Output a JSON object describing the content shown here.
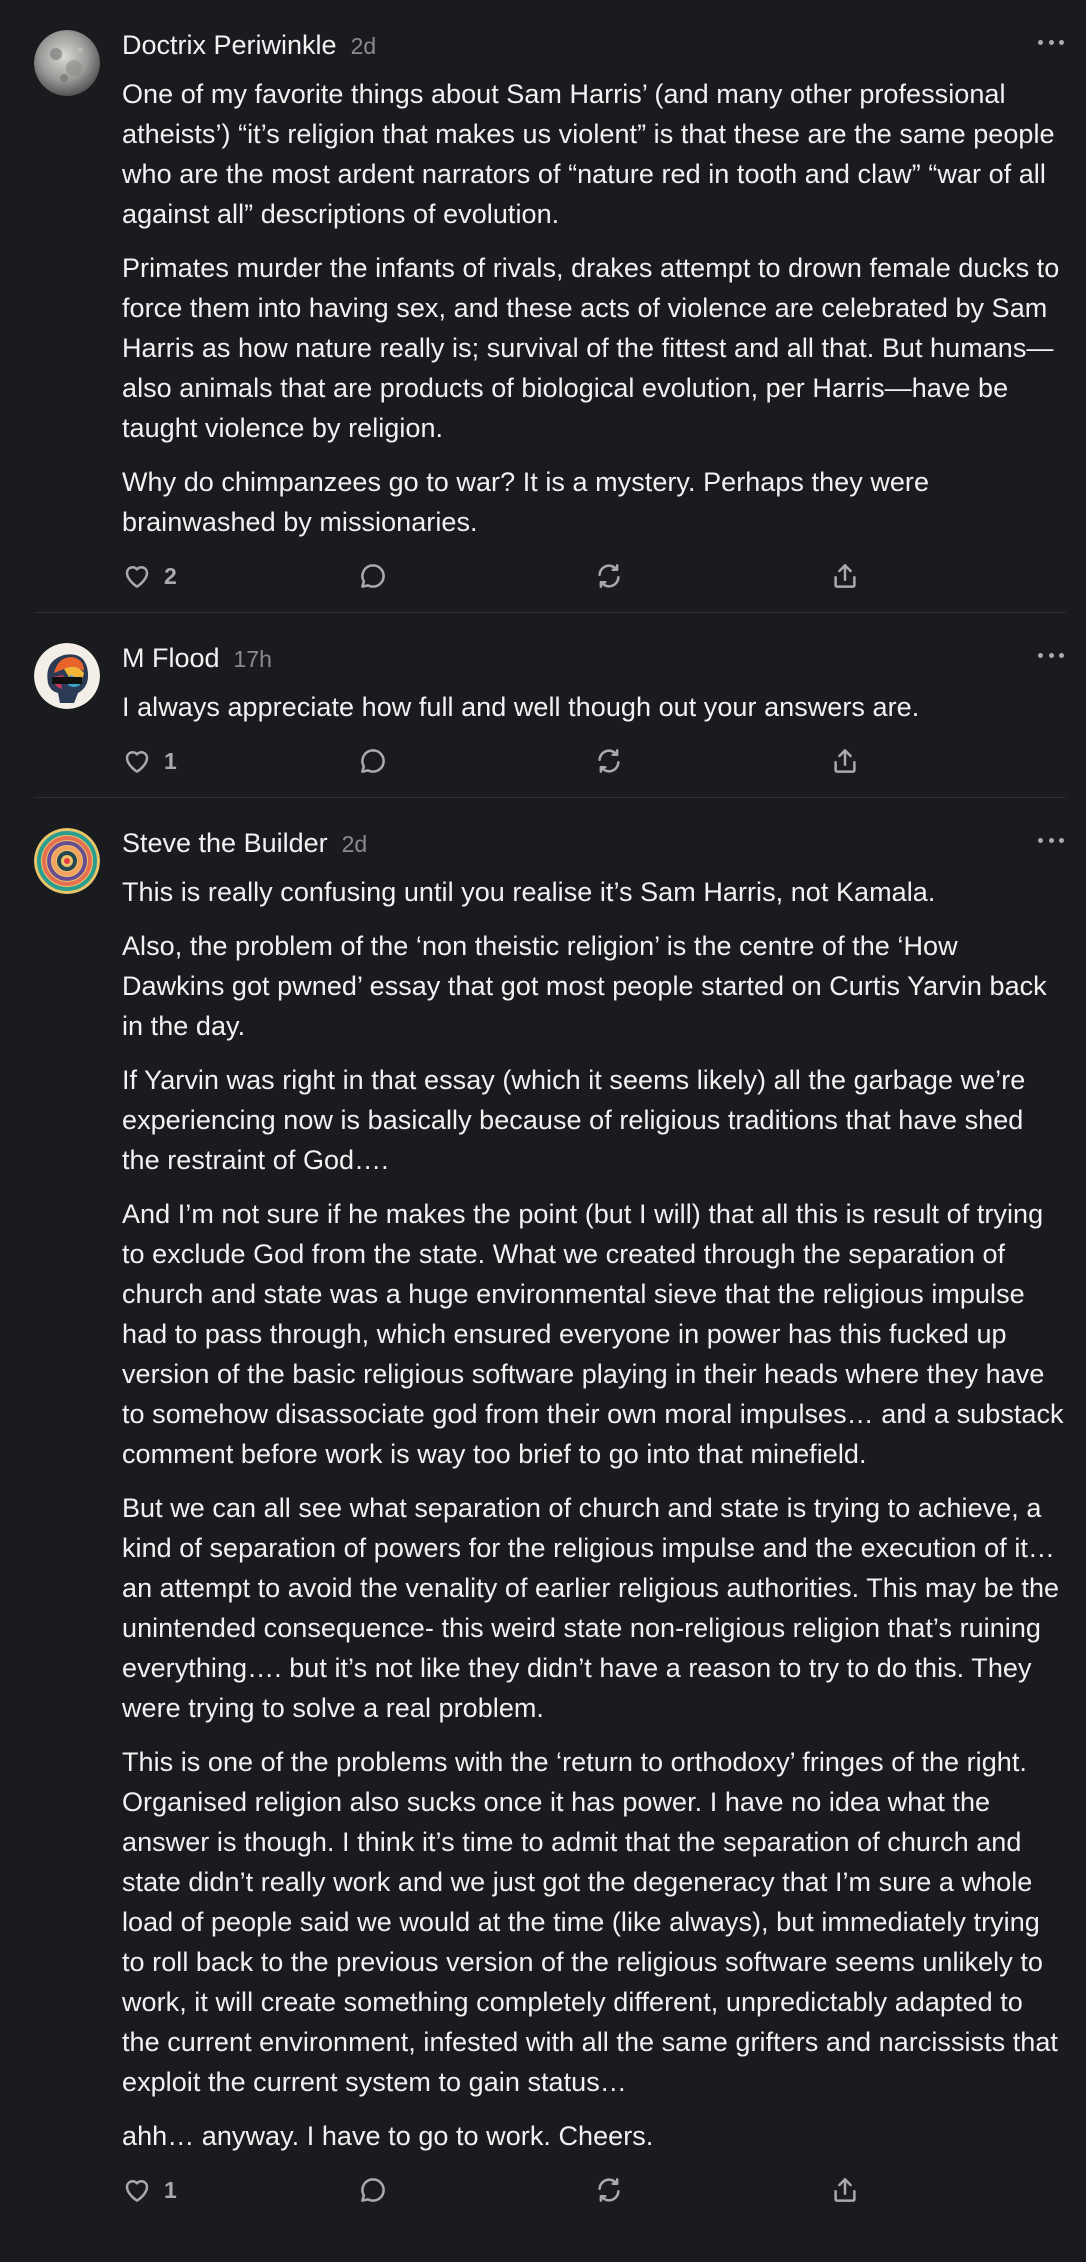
{
  "colors": {
    "background": "#1a1b1e",
    "text": "#f2f2f3",
    "muted": "#8a8b90",
    "icon": "#a9aab0",
    "divider": "#2e2f33"
  },
  "comments": [
    {
      "author": "Doctrix Periwinkle",
      "time": "2d",
      "avatar_icon": "moon-avatar",
      "paragraphs": [
        "One of my favorite things about Sam Harris’ (and many other professional atheists’) “it’s religion that makes us violent” is that these are the same people who are the most ardent narrators of “nature red in tooth and claw” “war of all against all” descriptions of evolution.",
        "Primates murder the infants of rivals, drakes attempt to drown female ducks to force them into having sex, and these acts of violence are celebrated by Sam Harris as how nature really is; survival of the fittest and all that. But humans—also animals that are products of biological evolution, per Harris—have be taught violence by religion.",
        "Why do chimpanzees go to war? It is a mystery. Perhaps they were brainwashed by missionaries."
      ],
      "likes": "2"
    },
    {
      "author": "M Flood",
      "time": "17h",
      "avatar_icon": "colorful-head-avatar",
      "paragraphs": [
        "I always appreciate how full and well though out your answers are."
      ],
      "likes": "1"
    },
    {
      "author": "Steve the Builder",
      "time": "2d",
      "avatar_icon": "mandala-avatar",
      "paragraphs": [
        "This is really confusing until you realise it’s Sam Harris, not Kamala.",
        "Also, the problem of the ‘non theistic religion’ is the centre of the ‘How Dawkins got pwned’ essay that got most people started on Curtis Yarvin back in the day.",
        "If Yarvin was right in that essay (which it seems likely) all the garbage we’re experiencing now is basically because of religious traditions that have shed the restraint of God….",
        "And I’m not sure if he makes the point (but I will) that all this is result of trying to exclude God from the state. What we created through the separation of church and state was a huge environmental sieve that the religious impulse had to pass through, which ensured everyone in power has this fucked up version of the basic religious software playing in their heads where they have to somehow disassociate god from their own moral impulses… and a substack comment before work is way too brief to go into that minefield.",
        "But we can all see what separation of church and state is trying to achieve, a kind of separation of powers for the religious impulse and the execution of it… an attempt to avoid the venality of earlier religious authorities. This may be the unintended consequence- this weird state non-religious religion that’s ruining everything…. but it’s not like they didn’t have a reason to try to do this. They were trying to solve a real problem.",
        "This is one of the problems with the ‘return to orthodoxy’ fringes of the right. Organised religion also sucks once it has power. I have no idea what the answer is though. I think it’s time to admit that the separation of church and state didn’t really work and we just got the degeneracy that I’m sure a whole load of people said we would at the time (like always), but immediately trying to roll back to the previous version of the religious software seems unlikely to work, it will create something completely different, unpredictably adapted to the current environment, infested with all the same grifters and narcissists that exploit the current system to gain status…",
        "ahh… anyway. I have to go to work. Cheers."
      ],
      "likes": "1"
    }
  ]
}
